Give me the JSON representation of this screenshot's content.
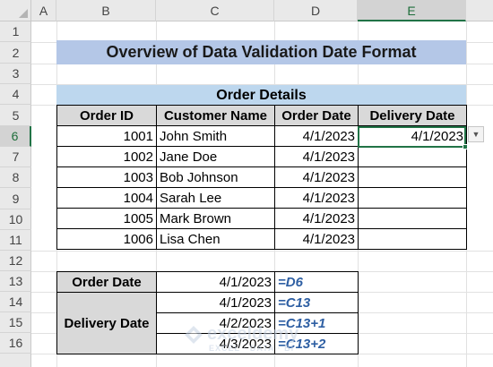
{
  "columns": [
    "A",
    "B",
    "C",
    "D",
    "E"
  ],
  "rows": [
    "1",
    "2",
    "3",
    "4",
    "5",
    "6",
    "7",
    "8",
    "9",
    "10",
    "11",
    "12",
    "13",
    "14",
    "15",
    "16"
  ],
  "title": "Overview of Data Validation Date Format",
  "order_table": {
    "title": "Order Details",
    "headers": [
      "Order ID",
      "Customer Name",
      "Order Date",
      "Delivery Date"
    ],
    "rows": [
      {
        "id": "1001",
        "name": "John Smith",
        "order_date": "4/1/2023",
        "delivery_date": "4/1/2023"
      },
      {
        "id": "1002",
        "name": "Jane Doe",
        "order_date": "4/1/2023",
        "delivery_date": ""
      },
      {
        "id": "1003",
        "name": "Bob Johnson",
        "order_date": "4/1/2023",
        "delivery_date": ""
      },
      {
        "id": "1004",
        "name": "Sarah Lee",
        "order_date": "4/1/2023",
        "delivery_date": ""
      },
      {
        "id": "1005",
        "name": "Mark Brown",
        "order_date": "4/1/2023",
        "delivery_date": ""
      },
      {
        "id": "1006",
        "name": "Lisa Chen",
        "order_date": "4/1/2023",
        "delivery_date": ""
      }
    ]
  },
  "summary_table": {
    "order_date_label": "Order Date",
    "order_date_value": "4/1/2023",
    "order_date_formula": "=D6",
    "delivery_date_label": "Delivery Date",
    "delivery_rows": [
      {
        "value": "4/1/2023",
        "formula": "=C13"
      },
      {
        "value": "4/2/2023",
        "formula": "=C13+1"
      },
      {
        "value": "4/3/2023",
        "formula": "=C13+2"
      }
    ]
  },
  "active_cell": "E6",
  "watermark": {
    "text": "exceldemy",
    "subtext": "EXCEL · DATA · BI"
  },
  "colors": {
    "accent": "#217346",
    "title_fill": "#b4c7e7",
    "section_fill": "#bdd7ee",
    "header_fill": "#d9d9d9",
    "formula": "#2e5fa3"
  },
  "icons": {
    "dropdown": "chevron-down-icon",
    "corner": "select-all-icon"
  }
}
